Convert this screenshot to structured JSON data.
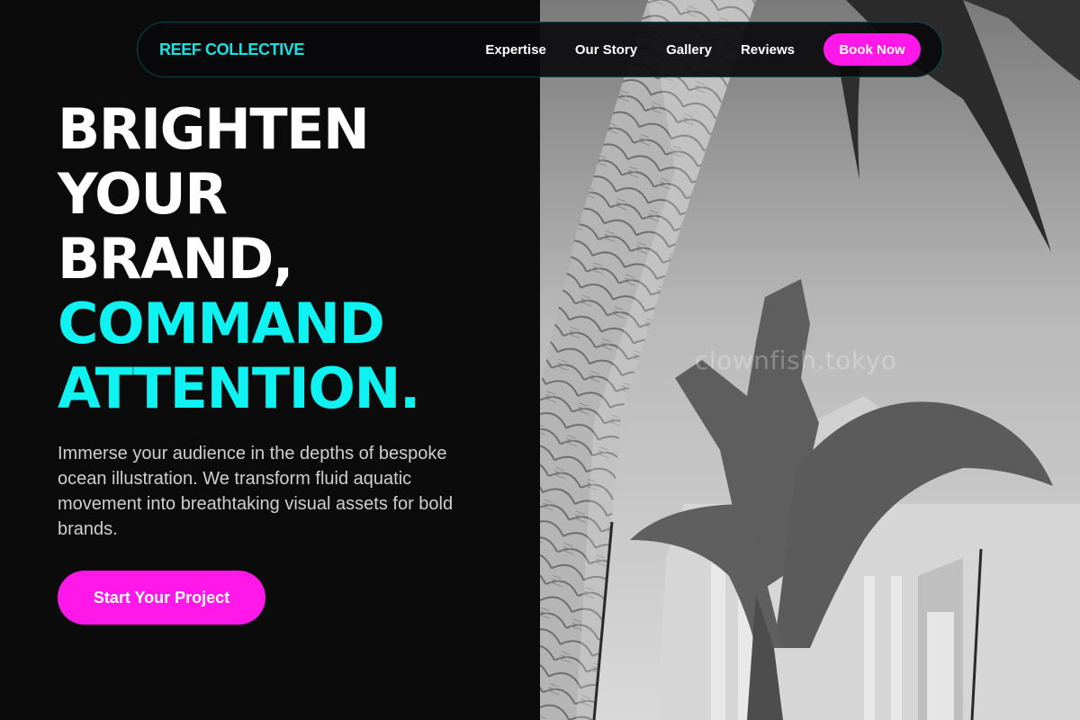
{
  "nav": {
    "brand": "REEF COLLECTIVE",
    "links": [
      "Expertise",
      "Our Story",
      "Gallery",
      "Reviews"
    ],
    "cta_label": "Book Now"
  },
  "hero": {
    "headline_white": [
      "BRIGHTEN",
      "YOUR",
      "BRAND,"
    ],
    "headline_cyan": [
      "COMMAND",
      "ATTENTION."
    ],
    "description": "Immerse your audience in the depths of bespoke ocean illustration. We transform fluid aquatic movement into breathtaking visual assets for bold brands.",
    "cta_label": "Start Your Project"
  },
  "image": {
    "watermark": "clownfish.tokyo"
  },
  "colors": {
    "background": "#0b0b0c",
    "accent_cyan": "#0ff2f2",
    "accent_magenta": "#ff18e8"
  },
  "icons": [
    "hero-illustration"
  ]
}
